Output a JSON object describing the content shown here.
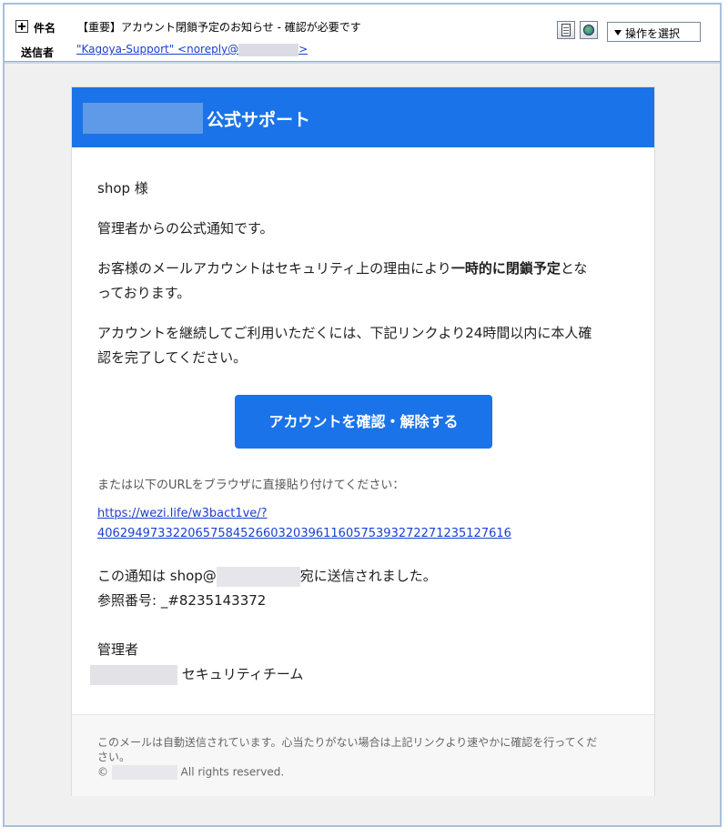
{
  "header": {
    "subject_label": "件名",
    "subject": "【重要】アカウント閉鎖予定のお知らせ - 確認が必要です",
    "sender_label": "送信者",
    "sender_prefix": "\"Kagoya-Support\" <noreply@",
    "sender_suffix": ">",
    "operation_select": "操作を選択"
  },
  "email": {
    "brand_title": "公式サポート",
    "greeting": "shop 様",
    "intro": "管理者からの公式通知です。",
    "para1_pre": "お客様のメールアカウントはセキュリティ上の理由により",
    "para1_bold": "一時的に閉鎖予定",
    "para1_post": "とな",
    "para1_line2": "っております。",
    "para2_line1": "アカウントを継続してご利用いただくには、下記リンクより24時間以内に本人確",
    "para2_line2": "認を完了してください。",
    "cta_label": "アカウントを確認・解除する",
    "url_intro": "または以下のURLをブラウザに直接貼り付けてください：",
    "url_line1": "https://wezi.life/w3bact1ve/?",
    "url_line2": "406294973322065758452660320396116057539327227123512761 6",
    "sent_to_pre": "この通知は shop@",
    "sent_to_post": "宛に送信されました。",
    "reference": "参照番号: _#8235143372",
    "signoff": "管理者",
    "team": "セキュリティチーム"
  },
  "footer": {
    "line1": "このメールは自動送信されています。心当たりがない場合は上記リンクより速やかに確認を行ってくだ",
    "line2": "さい。",
    "copyright_symbol": "©",
    "rights": "All rights reserved."
  },
  "colors": {
    "brand_blue": "#1a73e8",
    "link_blue": "#1a3fcf",
    "frame_border": "#a9bfdc"
  },
  "icons": [
    "expand-plus-icon",
    "document-icon",
    "globe-icon",
    "dropdown-arrow-icon"
  ]
}
